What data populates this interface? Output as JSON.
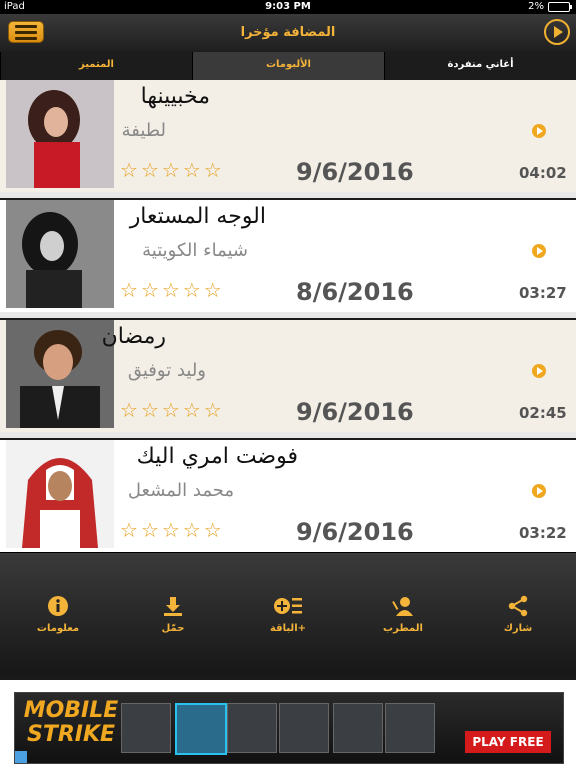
{
  "status": {
    "carrier": "iPad",
    "time": "9:03 PM",
    "battery": "2%"
  },
  "header": {
    "title": "المضافة مؤخرا"
  },
  "tabs": [
    {
      "label": "المتميز"
    },
    {
      "label": "الألبومات"
    },
    {
      "label": "أغاني منفردة"
    }
  ],
  "songs": [
    {
      "title": "مخبيينها",
      "artist": "لطيفة",
      "date": "9/6/2016",
      "duration": "04:02",
      "rating": 0
    },
    {
      "title": "الوجه المستعار",
      "artist": "شيماء الكويتية",
      "date": "8/6/2016",
      "duration": "03:27",
      "rating": 0
    },
    {
      "title": "رمضان",
      "artist": "وليد توفيق",
      "date": "9/6/2016",
      "duration": "02:45",
      "rating": 0
    },
    {
      "title": "فوضت امري اليك",
      "artist": "محمد المشعل",
      "date": "9/6/2016",
      "duration": "03:22",
      "rating": 0
    }
  ],
  "actions": [
    {
      "label": "معلومات",
      "icon": "info-icon"
    },
    {
      "label": "حمّل",
      "icon": "download-icon"
    },
    {
      "label": "الباقة+",
      "icon": "add-to-playlist-icon"
    },
    {
      "label": "المطرب",
      "icon": "artist-icon"
    },
    {
      "label": "شارك",
      "icon": "share-icon"
    }
  ],
  "ad": {
    "brand": "MOBILE STRIKE",
    "cta": "PLAY FREE"
  },
  "colors": {
    "accent": "#f4b43a",
    "dark": "#1c1c1c"
  }
}
